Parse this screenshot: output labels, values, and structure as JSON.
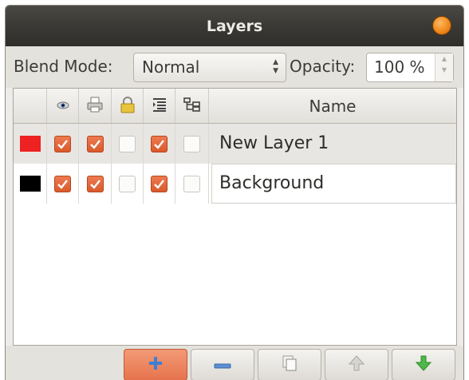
{
  "window": {
    "title": "Layers"
  },
  "toolbar": {
    "blend_label": "Blend Mode:",
    "blend_value": "Normal",
    "opacity_label": "Opacity:",
    "opacity_value": "100 %"
  },
  "columns": {
    "name_header": "Name",
    "icons": [
      "eye-icon",
      "printer-icon",
      "lock-icon",
      "text-indent-icon",
      "hierarchy-icon"
    ]
  },
  "layers": [
    {
      "name": "New Layer 1",
      "color": "#ee2222",
      "visible": true,
      "printable": true,
      "locked": false,
      "indented": true,
      "linked": false,
      "selected": true
    },
    {
      "name": "Background",
      "color": "#000000",
      "visible": true,
      "printable": true,
      "locked": false,
      "indented": true,
      "linked": false,
      "selected": false
    }
  ],
  "actions": [
    {
      "name": "add-layer-button",
      "icon": "plus-icon"
    },
    {
      "name": "remove-layer-button",
      "icon": "minus-icon"
    },
    {
      "name": "duplicate-layer-button",
      "icon": "duplicate-icon"
    },
    {
      "name": "raise-layer-button",
      "icon": "arrow-up-icon"
    },
    {
      "name": "lower-layer-button",
      "icon": "arrow-down-icon"
    }
  ],
  "colors": {
    "accent": "#e6744d",
    "check": "#d95a2b",
    "titlebar": "#3a3935"
  }
}
